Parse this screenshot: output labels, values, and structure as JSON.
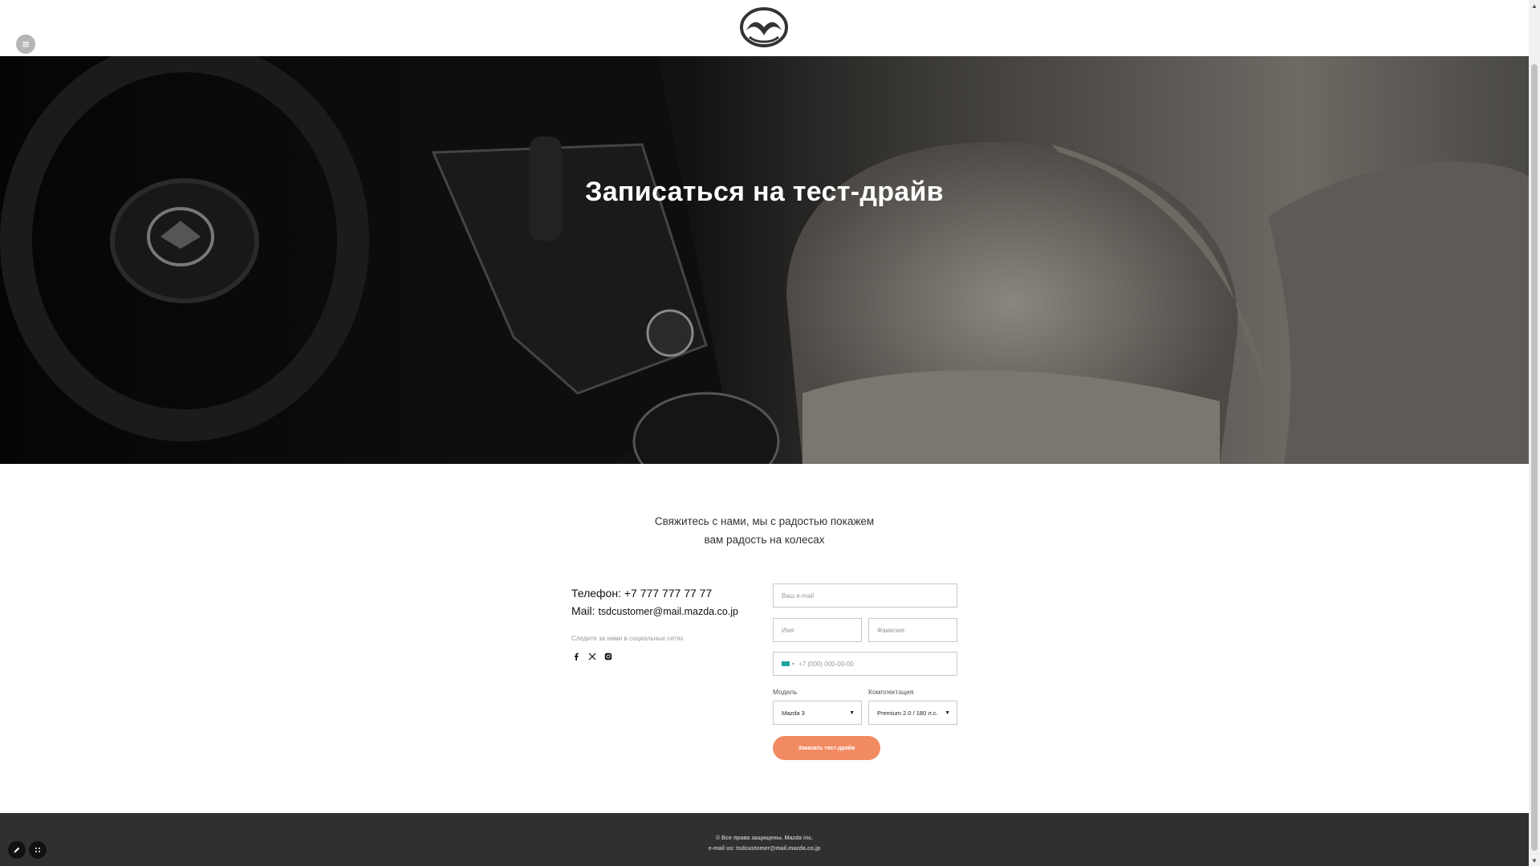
{
  "header": {
    "logo_icon": "mazda-logo-icon",
    "menu_icon": "menu-icon"
  },
  "hero": {
    "title": "Записаться на тест-драйв"
  },
  "tagline": {
    "line1": "Свяжитесь с нами, мы с радостью покажем",
    "line2": "вам радость на колесах"
  },
  "contacts": {
    "phone_label": "Телефон:",
    "phone_value": "+7 777 777 77 77",
    "mail_label": "Mail:",
    "mail_value": "tsdcustomer@mail.mazda.co.jp",
    "follow_text": "Следите за нами в социальных сетях",
    "socials": [
      "facebook-icon",
      "x-twitter-icon",
      "instagram-icon"
    ]
  },
  "form": {
    "email_placeholder": "Ваш e-mail",
    "name_placeholder": "Имя",
    "surname_placeholder": "Фамилия",
    "phone_placeholder": "+7 (000) 000-00-00",
    "model_label": "Модель",
    "model_value": "Mazda 3",
    "trim_label": "Комплектация",
    "trim_value": "Premium 2.0 / 180 л.с.",
    "submit_label": "Заказать тест-драйв"
  },
  "footer": {
    "line1": "© Все права защищены. Mazda inc.",
    "line2": "e-mail us: tsdcustomer@mail.mazda.co.jp"
  },
  "colors": {
    "accent": "#f28a62",
    "footer_bg": "#303030",
    "flag": "#1aa5a0"
  }
}
